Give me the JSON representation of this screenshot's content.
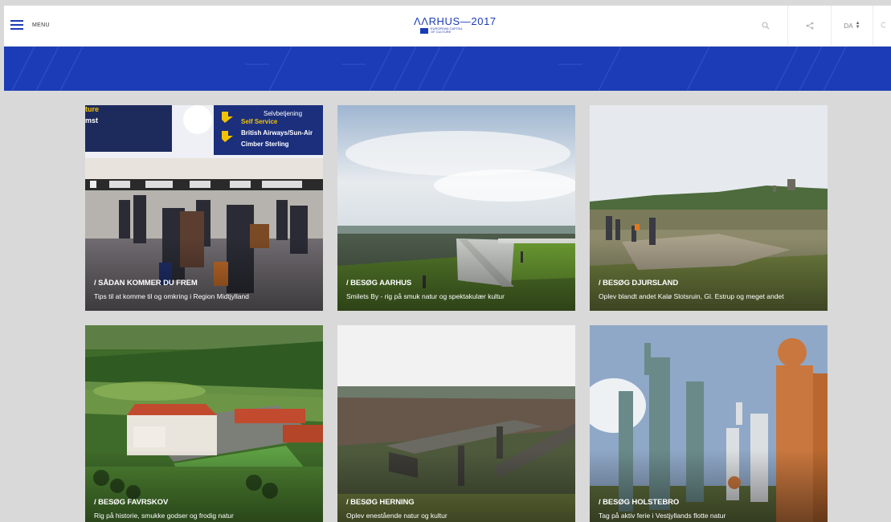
{
  "header": {
    "menu_label": "MENU",
    "logo": {
      "title": "ΛΛRHUS—2017",
      "subtitle_line1": "EUROPEAN CAPITAL",
      "subtitle_line2": "OF CULTURE"
    },
    "search_icon": "search-icon",
    "share_icon": "share-icon",
    "language": "DA",
    "more_icon": "more-icon"
  },
  "cards": [
    {
      "kicker": "/ SÅDAN KOMMER DU FREM",
      "desc": "Tips til at komme til og omkring i Region Midtjylland"
    },
    {
      "kicker": "/ BESØG AARHUS",
      "desc": "Smilets By - rig på smuk natur og spektakulær kultur"
    },
    {
      "kicker": "/ BESØG DJURSLAND",
      "desc": "Oplev blandt andet Kalø Slotsruin, Gl. Estrup og meget andet"
    },
    {
      "kicker": "/ BESØG FAVRSKOV",
      "desc": "Rig på historie, smukke godser og frodig natur"
    },
    {
      "kicker": "/ BESØG HERNING",
      "desc": "Oplev enestående natur og kultur"
    },
    {
      "kicker": "/ BESØG HOLSTEBRO",
      "desc": "Tag på aktiv ferie i Vestjyllands flotte natur"
    }
  ],
  "airport_signs": [
    "Selvbetjening",
    "Self Service",
    "British Airways/Sun-Air",
    "Cimber Sterling",
    "ture",
    "mst"
  ],
  "colors": {
    "brand_blue": "#1b3cb6",
    "background": "#d9d9d9"
  }
}
